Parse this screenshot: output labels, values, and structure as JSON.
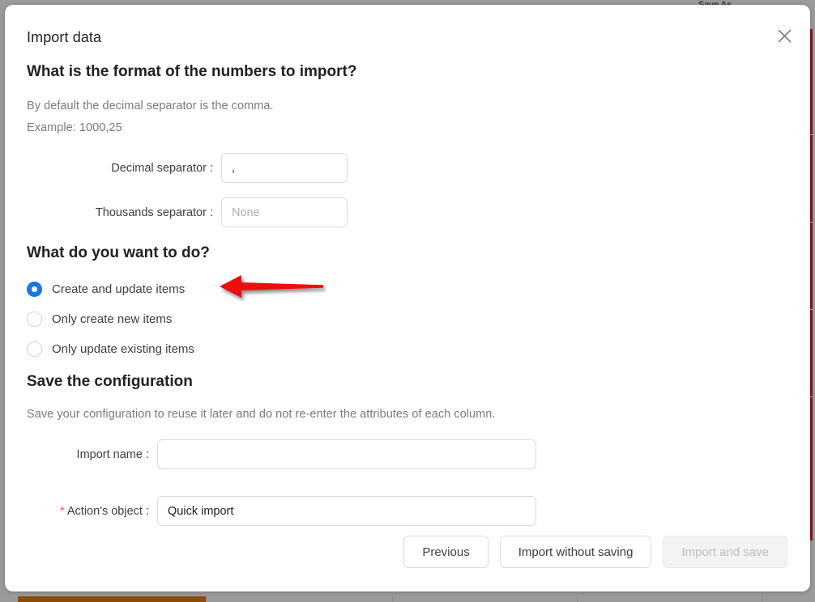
{
  "background": {
    "top_label": "Save As",
    "right_strip_color": "#8c1515",
    "bottom_bar_color": "#8a4b07"
  },
  "dialog": {
    "title": "Import data",
    "close_icon": "close-icon",
    "sections": {
      "format": {
        "heading": "What is the format of the numbers to import?",
        "desc_line_1": "By default the decimal separator is the comma.",
        "desc_line_2": "Example: 1000,25",
        "fields": [
          {
            "label": "Decimal separator :",
            "value": ",",
            "placeholder": ""
          },
          {
            "label": "Thousands separator :",
            "value": "",
            "placeholder": "None"
          }
        ]
      },
      "action": {
        "heading": "What do you want to do?",
        "options": [
          {
            "label": "Create and update items",
            "selected": true
          },
          {
            "label": "Only create new items",
            "selected": false
          },
          {
            "label": "Only update existing items",
            "selected": false
          }
        ]
      },
      "save": {
        "heading": "Save the configuration",
        "description": "Save your configuration to reuse it later and do not re-enter the attributes of each column.",
        "fields": [
          {
            "label": "Import name :",
            "required": false,
            "value": "",
            "placeholder": ""
          },
          {
            "label": "Action's object :",
            "required": true,
            "required_mark": "*",
            "value": "Quick import",
            "placeholder": ""
          }
        ]
      }
    },
    "footer": {
      "buttons": [
        {
          "label": "Previous",
          "disabled": false
        },
        {
          "label": "Import without saving",
          "disabled": false
        },
        {
          "label": "Import and save",
          "disabled": true
        }
      ]
    }
  },
  "annotation": {
    "type": "arrow",
    "direction": "left",
    "color": "#ee1111",
    "points_at": "Create and update items"
  },
  "colors": {
    "accent_blue": "#1a73e8",
    "required_red": "#e8556d",
    "annotation_red": "#ee1111",
    "text_primary": "#202124",
    "text_muted": "#7b7b7b",
    "border": "#dcdcdc"
  }
}
